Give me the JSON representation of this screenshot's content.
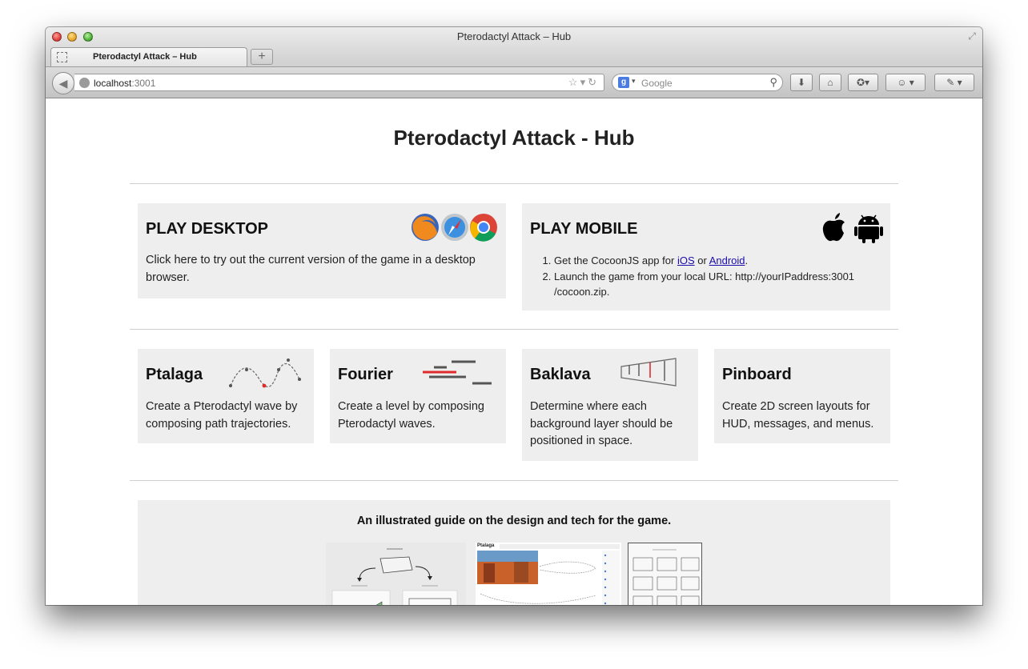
{
  "window": {
    "title": "Pterodactyl Attack – Hub",
    "tab_label": "Pterodactyl Attack – Hub",
    "new_tab_label": "+",
    "url_host": "localhost",
    "url_port": ":3001",
    "search_placeholder": "Google"
  },
  "page": {
    "title": "Pterodactyl Attack - Hub",
    "play_desktop": {
      "heading": "PLAY DESKTOP",
      "text": "Click here to try out the current version of the game in a desktop browser."
    },
    "play_mobile": {
      "heading": "PLAY MOBILE",
      "step1_prefix": "Get the CocoonJS app for ",
      "ios_link": "iOS",
      "step1_or": " or ",
      "android_link": "Android",
      "step1_suffix": ".",
      "step2": "Launch the game from your local URL: http://yourIPaddress:3001 /cocoon.zip."
    },
    "tools": [
      {
        "heading": "Ptalaga",
        "text": "Create a Pterodactyl wave by composing path trajectories."
      },
      {
        "heading": "Fourier",
        "text": "Create a level by composing Pterodactyl waves."
      },
      {
        "heading": "Baklava",
        "text": "Determine where each background layer should be positioned in space."
      },
      {
        "heading": "Pinboard",
        "text": "Create 2D screen layouts for HUD, messages, and menus."
      }
    ],
    "guide": {
      "title": "An illustrated guide on the design and tech for the game.",
      "thumb2_label": "Ptalaga"
    }
  },
  "colors": {
    "card_bg": "#eeeeee",
    "link": "#1a0dab",
    "accent_red": "#e02b2b"
  }
}
